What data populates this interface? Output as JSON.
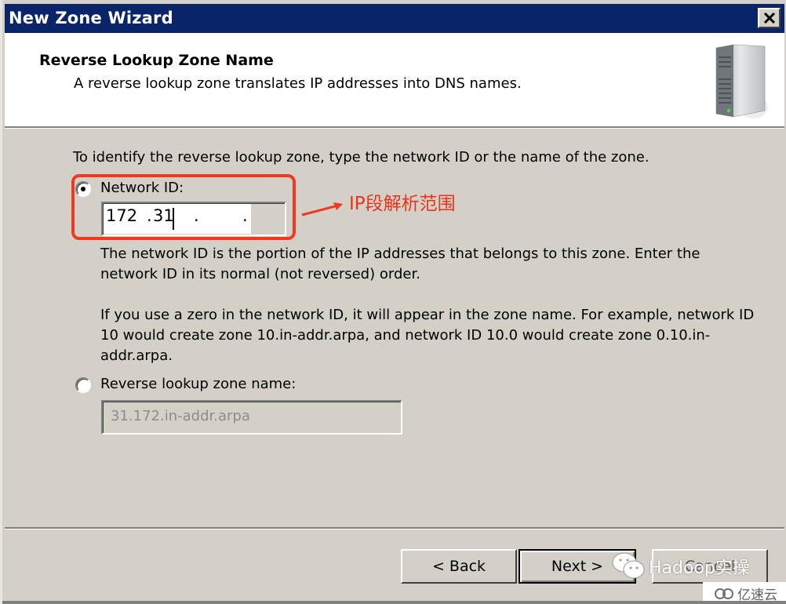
{
  "window": {
    "title": "New Zone Wizard",
    "close_icon": "close-x-icon"
  },
  "header": {
    "title": "Reverse Lookup Zone Name",
    "subtitle": "A reverse lookup zone translates IP addresses into DNS names.",
    "icon": "server-tower-icon"
  },
  "content": {
    "intro": "To identify the reverse lookup zone, type the network ID or the name of the zone.",
    "network_id": {
      "label": "Network ID:",
      "selected": true,
      "segments": [
        "172",
        "31",
        "",
        ""
      ],
      "dots": [
        ".",
        ".",
        "."
      ]
    },
    "network_id_help_1": "The network ID is the portion of the IP addresses that belongs to this zone. Enter the network ID in its normal (not reversed) order.",
    "network_id_help_2": "If you use a zero in the network ID, it will appear in the zone name. For example, network ID 10 would create zone 10.in-addr.arpa, and network ID 10.0 would create zone 0.10.in-addr.arpa.",
    "zone_name": {
      "label": "Reverse lookup zone name:",
      "selected": false,
      "value": "31.172.in-addr.arpa"
    }
  },
  "annotation": {
    "text": "IP段解析范围",
    "color": "#e8341c"
  },
  "buttons": {
    "back": "< Back",
    "next": "Next >",
    "cancel": "Cancel"
  },
  "watermark": {
    "text": "Hadoop实操",
    "logo_text": "亿速云"
  },
  "colors": {
    "titlebar": "#0a246a",
    "face": "#d4d0c8",
    "annotation": "#f03a1e"
  }
}
